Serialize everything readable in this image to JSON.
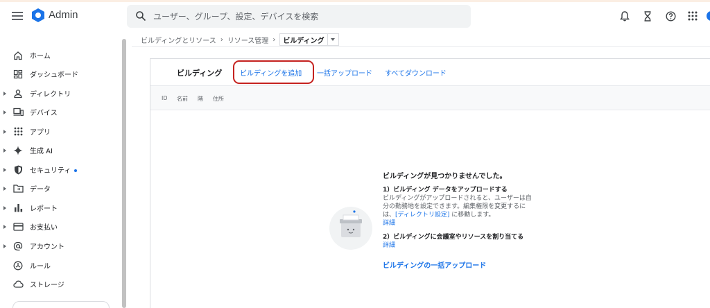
{
  "header": {
    "brand": "Admin",
    "search_placeholder": "ユーザー、グループ、設定、デバイスを検索"
  },
  "sidebar": {
    "items": [
      {
        "label": "ホーム",
        "icon": "home-icon",
        "expandable": false
      },
      {
        "label": "ダッシュボード",
        "icon": "dashboard-icon",
        "expandable": false
      },
      {
        "label": "ディレクトリ",
        "icon": "person-icon",
        "expandable": true
      },
      {
        "label": "デバイス",
        "icon": "devices-icon",
        "expandable": true
      },
      {
        "label": "アプリ",
        "icon": "apps-grid-icon",
        "expandable": true
      },
      {
        "label": "生成 AI",
        "icon": "sparkle-icon",
        "expandable": true
      },
      {
        "label": "セキュリティ",
        "icon": "shield-icon",
        "expandable": true,
        "dot": true
      },
      {
        "label": "データ",
        "icon": "folder-icon",
        "expandable": true
      },
      {
        "label": "レポート",
        "icon": "bar-chart-icon",
        "expandable": true
      },
      {
        "label": "お支払い",
        "icon": "credit-card-icon",
        "expandable": true
      },
      {
        "label": "アカウント",
        "icon": "at-sign-icon",
        "expandable": true
      },
      {
        "label": "ルール",
        "icon": "rule-icon",
        "expandable": false
      },
      {
        "label": "ストレージ",
        "icon": "cloud-icon",
        "expandable": false
      }
    ]
  },
  "breadcrumb": {
    "items": [
      "ビルディングとリソース",
      "リソース管理"
    ],
    "current": "ビルディング"
  },
  "card": {
    "title": "ビルディング",
    "links": [
      "ビルディングを追加",
      "一括アップロード",
      "すべてダウンロード"
    ],
    "columns": [
      "ID",
      "名前",
      "階",
      "住所"
    ]
  },
  "empty_state": {
    "title": "ビルディングが見つかりませんでした。",
    "step1_title": "1）ビルディング データをアップロードする",
    "step1_desc_before": "ビルディングがアップロードされると、ユーザーは自分の勤務地を設定できます。編集権限を変更するには、",
    "step1_desc_link": "[ディレクトリ設定]",
    "step1_desc_after": " に移動します。",
    "step1_link": "詳細",
    "step2_title": "2）ビルディングに会議室やリソースを割り当てる",
    "step2_link": "詳細",
    "bulk_link": "ビルディングの一括アップロード"
  },
  "colors": {
    "accent": "#1a73e8",
    "highlight": "#c5221f"
  }
}
